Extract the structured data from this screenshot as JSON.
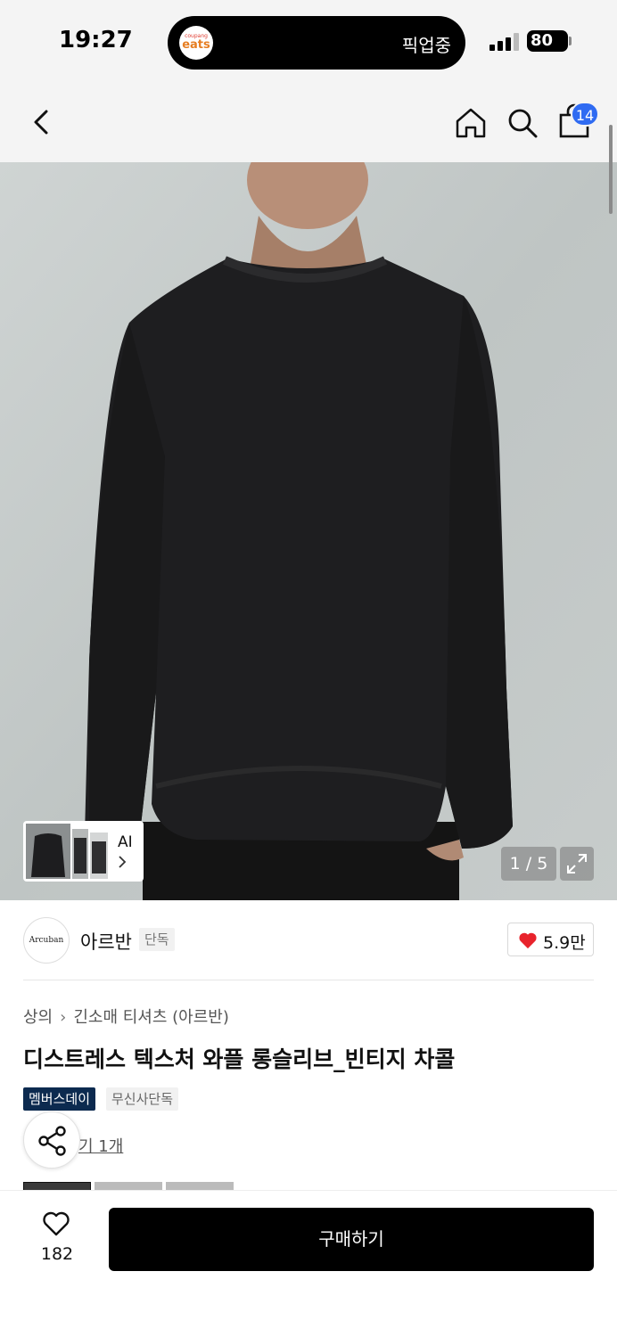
{
  "status_bar": {
    "time": "19:27",
    "live_activity": {
      "logo_small": "coupang",
      "logo_big": "eats",
      "text": "픽업중"
    },
    "battery": "80"
  },
  "nav": {
    "icons": [
      "back-icon",
      "home-icon",
      "search-icon",
      "shopping-bag-icon"
    ],
    "cart_badge": "14"
  },
  "hero": {
    "ai_label": "AI",
    "page_indicator": "1 / 5"
  },
  "brand": {
    "logo_text": "Arcuban",
    "name": "아르반",
    "tag": "단독",
    "likes": "5.9만"
  },
  "product": {
    "breadcrumb": [
      "상의",
      "긴소매 티셔츠 (아르반)"
    ],
    "title": "디스트레스 텍스처 와플 롱슬리브_빈티지 차콜",
    "tags": [
      "멤버스데이",
      "무신사단독"
    ],
    "review_link_visible": "기 1개"
  },
  "bottom_bar": {
    "wish_count": "182",
    "buy_label": "구매하기"
  },
  "colors": {
    "accent_blue": "#2f6bf2",
    "member_tag": "#0c2a4f",
    "heart_red": "#e8232c",
    "buy_button": "#000000"
  }
}
